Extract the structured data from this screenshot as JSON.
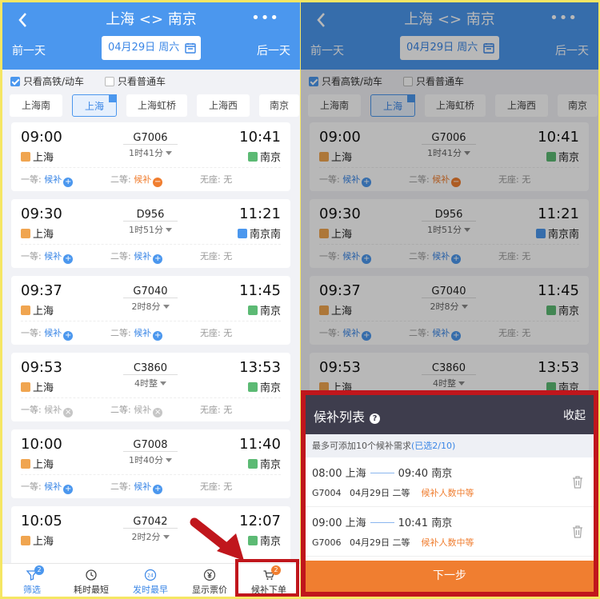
{
  "header": {
    "title": "上海 <> 南京",
    "prev_day": "前一天",
    "next_day": "后一天",
    "date": "04月29日 周六",
    "more": "•••"
  },
  "filters": {
    "gaotie": "只看高铁/动车",
    "putong": "只看普通车"
  },
  "stations": [
    "上海南",
    "上海",
    "上海虹桥",
    "上海西",
    "南京"
  ],
  "trains": [
    {
      "dep": "09:00",
      "arr": "10:41",
      "num": "G7006",
      "dur": "1时41分",
      "from": "上海",
      "to": "南京",
      "s1": "一等:",
      "s1v": "候补",
      "s2": "二等:",
      "s2v": "候补",
      "s3": "无座: 无"
    },
    {
      "dep": "09:30",
      "arr": "11:21",
      "num": "D956",
      "dur": "1时51分",
      "from": "上海",
      "to": "南京南",
      "s1": "一等:",
      "s1v": "候补",
      "s2": "二等:",
      "s2v": "候补",
      "s3": "无座: 无"
    },
    {
      "dep": "09:37",
      "arr": "11:45",
      "num": "G7040",
      "dur": "2时8分",
      "from": "上海",
      "to": "南京",
      "s1": "一等:",
      "s1v": "候补",
      "s2": "二等:",
      "s2v": "候补",
      "s3": "无座: 无"
    },
    {
      "dep": "09:53",
      "arr": "13:53",
      "num": "C3860",
      "dur": "4时整",
      "from": "上海",
      "to": "南京",
      "s1": "一等:",
      "s1v": "候补",
      "s2": "二等:",
      "s2v": "候补",
      "s3": "无座: 无"
    },
    {
      "dep": "10:00",
      "arr": "11:40",
      "num": "G7008",
      "dur": "1时40分",
      "from": "上海",
      "to": "南京",
      "s1": "一等:",
      "s1v": "候补",
      "s2": "二等:",
      "s2v": "候补",
      "s3": "无座: 无"
    },
    {
      "dep": "10:05",
      "arr": "12:07",
      "num": "G7042",
      "dur": "2时2分",
      "from": "上海",
      "to": "南京"
    }
  ],
  "nav": {
    "filter": "筛选",
    "filter_badge": "2",
    "shortest": "耗时最短",
    "earliest": "发时最早",
    "earliest_icon": "24",
    "price": "显示票价",
    "order": "候补下单",
    "order_badge": "2"
  },
  "sheet": {
    "title": "候补列表",
    "collapse": "收起",
    "note": "最多可添加10个候补需求",
    "note_sel": "(已选2/10)",
    "items": [
      {
        "dep": "08:00 上海",
        "arr": "09:40 南京",
        "num": "G7004",
        "date": "04月29日",
        "cls": "二等",
        "wait": "候补人数中等"
      },
      {
        "dep": "09:00 上海",
        "arr": "10:41 南京",
        "num": "G7006",
        "date": "04月29日",
        "cls": "二等",
        "wait": "候补人数中等"
      }
    ],
    "next": "下一步"
  },
  "colors": {
    "header_blue": "#4b97ee",
    "accent_orange": "#f07e30",
    "highlight_red": "#c0161c",
    "sheet_dark": "#3e3d4d"
  }
}
